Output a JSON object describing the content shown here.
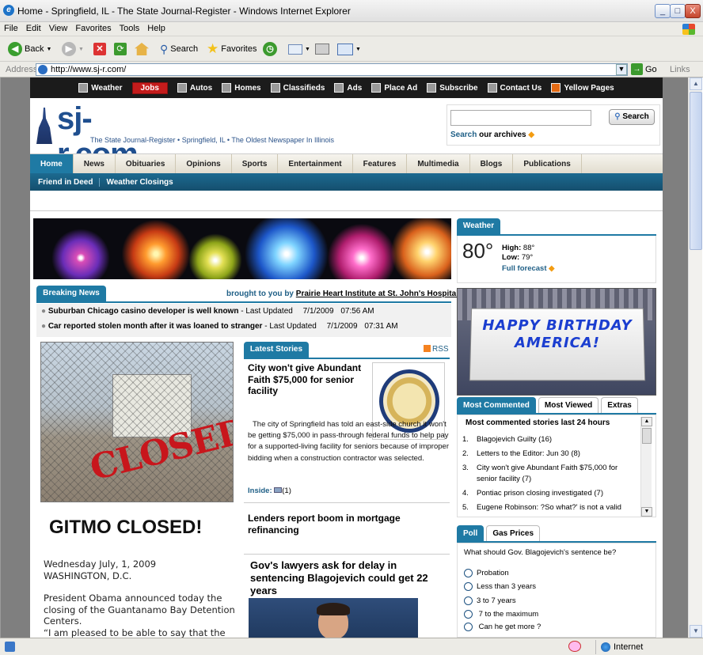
{
  "window": {
    "title": "Home - Springfield, IL - The State Journal-Register - Windows Internet Explorer",
    "min": "_",
    "max": "□",
    "close": "X"
  },
  "menu": [
    "File",
    "Edit",
    "View",
    "Favorites",
    "Tools",
    "Help"
  ],
  "toolbar": {
    "back": "Back",
    "search": "Search",
    "favorites": "Favorites"
  },
  "address": {
    "label": "Address",
    "url": "http://www.sj-r.com/",
    "go": "Go",
    "links": "Links"
  },
  "site": {
    "topnav": [
      "Weather",
      "Jobs",
      "Autos",
      "Homes",
      "Classifieds",
      "Ads",
      "Place Ad",
      "Subscribe",
      "Contact Us",
      "Yellow Pages"
    ],
    "logo": "sj-r.com",
    "tagline": "The State Journal-Register • Springfield, IL • The Oldest Newspaper In Illinois",
    "search_button": "Search",
    "search_archives_a": "Search",
    "search_archives_b": "our archives",
    "mainnav": [
      "Home",
      "News",
      "Obituaries",
      "Opinions",
      "Sports",
      "Entertainment",
      "Features",
      "Multimedia",
      "Blogs",
      "Publications"
    ],
    "subnav": [
      "Friend in Deed",
      "Weather Closings"
    ]
  },
  "breaking": {
    "tab": "Breaking News",
    "sponsor_prefix": "brought to you by",
    "sponsor": "Prairie Heart Institute at St. John's Hospital",
    "items": [
      {
        "headline": "Suburban Chicago casino developer is well known",
        "updated": "- Last Updated",
        "date": "7/1/2009",
        "time": "07:56 AM"
      },
      {
        "headline": "Car reported stolen month after it was loaned to stranger",
        "updated": "- Last Updated",
        "date": "7/1/2009",
        "time": "07:31 AM"
      }
    ]
  },
  "gitmo": {
    "stamp": "CLOSED",
    "headline": "GITMO CLOSED!",
    "dateline1": "Wednesday July, 1, 2009",
    "dateline2": "WASHINGTON, D.C.",
    "para1": "President Obama announced today the closing of the Guantanamo Bay Detention Centers.",
    "para2": "“I am pleased to be able to say that the"
  },
  "latest": {
    "tab": "Latest Stories",
    "rss": "RSS",
    "story1_headline": "City won't give Abundant Faith $75,000 for senior facility",
    "story1_body": "The city of Springfield has told an east-side church it won't be getting $75,000 in pass-through federal funds to help pay for a supported-living facility for seniors because of improper bidding when a construction contractor was selected.",
    "inside_label": "Inside:",
    "inside_count": "(1)",
    "story2_headline": "Lenders report boom in mortgage refinancing",
    "story3_headline": "Gov's lawyers ask for delay in sentencing Blagojevich could get 22 years"
  },
  "weather": {
    "tab": "Weather",
    "temp": "80°",
    "high_label": "High:",
    "high": "88°",
    "low_label": "Low:",
    "low": "79°",
    "forecast": "Full forecast"
  },
  "birthday": {
    "text": "HAPPY BIRTHDAY AMERICA!"
  },
  "most_commented": {
    "tabs": [
      "Most Commented",
      "Most Viewed",
      "Extras"
    ],
    "heading": "Most commented stories last 24 hours",
    "items": [
      {
        "n": "1.",
        "text": "Blagojevich Guilty (16)"
      },
      {
        "n": "2.",
        "text": "Letters to the Editor: Jun 30  (8)"
      },
      {
        "n": "3.",
        "text": "City won't give Abundant Faith $75,000 for senior facility (7)"
      },
      {
        "n": "4.",
        "text": "Pontiac prison closing investigated (7)"
      },
      {
        "n": "5.",
        "text": "Eugene Robinson: ?So what?' is not a valid"
      }
    ]
  },
  "poll": {
    "tabs": [
      "Poll",
      "Gas Prices"
    ],
    "question": "What should Gov. Blagojevich's sentence be?",
    "options": [
      "Probation",
      "Less than 3 years",
      "3 to 7 years",
      " 7 to the maximum",
      " Can he get more ?"
    ]
  },
  "status": {
    "zone": "Internet"
  }
}
